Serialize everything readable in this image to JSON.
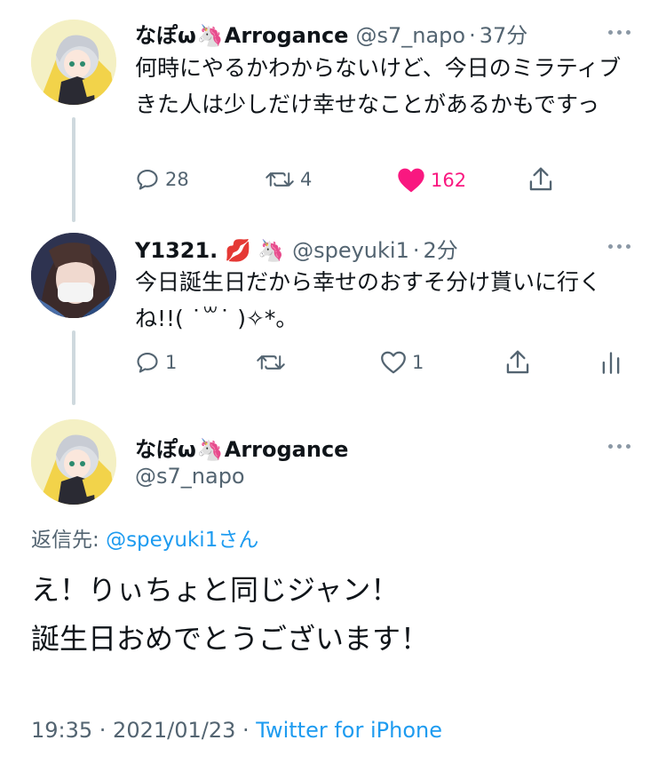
{
  "colors": {
    "accent": "#1d9bf0",
    "like": "#f91880",
    "muted": "#536471"
  },
  "tweet1": {
    "name": "なぽω",
    "emoji": "🦄",
    "name_suffix": "Arrogance",
    "handle": "@s7_napo",
    "sep": "·",
    "time": "37分",
    "text": "何時にやるかわからないけど、今日のミラティブきた人は少しだけ幸せなことがあるかもですっ",
    "reply_count": "28",
    "retweet_count": "4",
    "like_count": "162",
    "liked": true
  },
  "tweet2": {
    "name": "Y1321.",
    "emoji_lips": "💋",
    "emoji_unicorn": "🦄",
    "handle": "@speyuki1",
    "sep": "·",
    "time": "2分",
    "text": "今日誕生日だから幸せのおすそ分け貰いに行くね!!( ˙꒳˙ )✧*。",
    "reply_count": "1",
    "retweet_count": "",
    "like_count": "1"
  },
  "main_tweet": {
    "name": "なぽω",
    "emoji": "🦄",
    "name_suffix": "Arrogance",
    "handle": "@s7_napo",
    "reply_prefix": "返信先: ",
    "reply_target": "@speyuki1さん",
    "line1": "え！りぃちょと同じジャン！",
    "line2": "誕生日おめでとうございます！",
    "timestamp": "19:35 · 2021/01/23 · ",
    "source": "Twitter for iPhone"
  }
}
